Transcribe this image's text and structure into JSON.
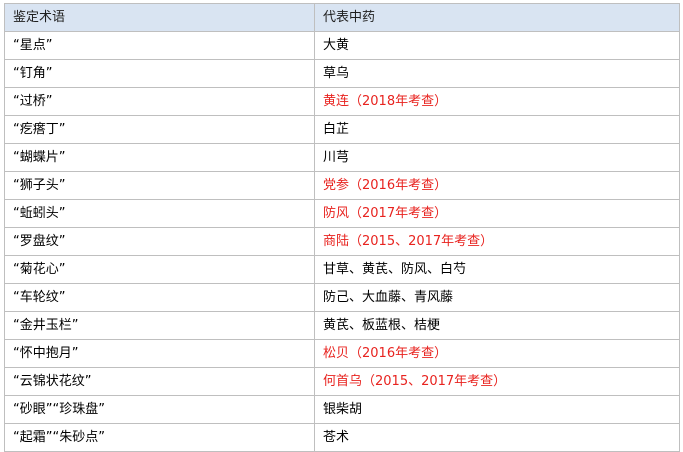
{
  "table": {
    "headers": [
      "鉴定术语",
      "代表中药"
    ],
    "rows": [
      {
        "term": "“星点”",
        "herb": "大黄",
        "highlight": false
      },
      {
        "term": "“钉角”",
        "herb": "草乌",
        "highlight": false
      },
      {
        "term": "“过桥”",
        "herb": "黄连（2018年考查）",
        "highlight": true
      },
      {
        "term": "“疙瘩丁”",
        "herb": "白芷",
        "highlight": false
      },
      {
        "term": "“蝴蝶片”",
        "herb": "川芎",
        "highlight": false
      },
      {
        "term": "“狮子头”",
        "herb": "党参（2016年考查）",
        "highlight": true
      },
      {
        "term": "“蚯蚓头”",
        "herb": "防风（2017年考查）",
        "highlight": true
      },
      {
        "term": "“罗盘纹”",
        "herb": "商陆（2015、2017年考查）",
        "highlight": true
      },
      {
        "term": "“菊花心”",
        "herb": "甘草、黄芪、防风、白芍",
        "highlight": false
      },
      {
        "term": "“车轮纹”",
        "herb": "防己、大血藤、青风藤",
        "highlight": false
      },
      {
        "term": "“金井玉栏”",
        "herb": "黄芪、板蓝根、桔梗",
        "highlight": false
      },
      {
        "term": "“怀中抱月”",
        "herb": "松贝（2016年考查）",
        "highlight": true
      },
      {
        "term": "“云锦状花纹”",
        "herb": "何首乌（2015、2017年考查）",
        "highlight": true
      },
      {
        "term": "“砂眼”“珍珠盘”",
        "herb": "银柴胡",
        "highlight": false
      },
      {
        "term": "“起霜”“朱砂点”",
        "herb": "苍术",
        "highlight": false
      }
    ]
  },
  "colors": {
    "header_bg": "#d9e4f2",
    "border": "#bfbfbf",
    "highlight_text": "#e8231f",
    "normal_text": "#000000"
  }
}
